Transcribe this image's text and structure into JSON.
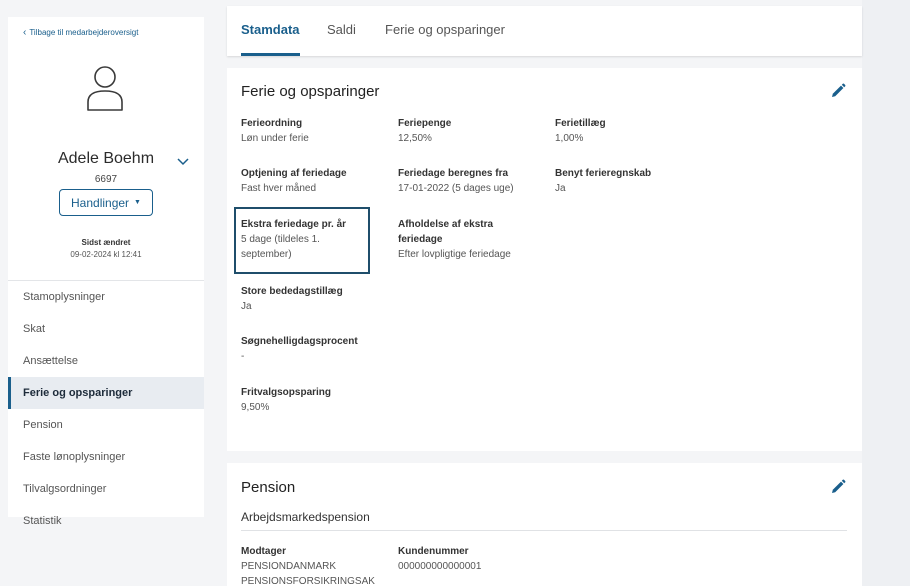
{
  "sidebar": {
    "back_label": "Tilbage til medarbejderoversigt",
    "employee_name": "Adele Boehm",
    "employee_number": "6697",
    "actions_label": "Handlinger",
    "last_changed_label": "Sidst ændret",
    "last_changed_value": "09-02-2024 kl 12:41",
    "nav_items": [
      {
        "label": "Stamoplysninger"
      },
      {
        "label": "Skat"
      },
      {
        "label": "Ansættelse"
      },
      {
        "label": "Ferie og opsparinger"
      },
      {
        "label": "Pension"
      },
      {
        "label": "Faste lønoplysninger"
      },
      {
        "label": "Tilvalgsordninger"
      },
      {
        "label": "Statistik"
      }
    ],
    "active_index": 3
  },
  "tabs": [
    {
      "label": "Stamdata",
      "active": true
    },
    {
      "label": "Saldi",
      "active": false
    },
    {
      "label": "Ferie og opsparinger",
      "active": false
    }
  ],
  "vacation_card": {
    "title": "Ferie og opsparinger",
    "fields": {
      "ferieordning": {
        "label": "Ferieordning",
        "value": "Løn under ferie"
      },
      "feriepenge": {
        "label": "Feriepenge",
        "value": "12,50%"
      },
      "ferietillaeg": {
        "label": "Ferietillæg",
        "value": "1,00%"
      },
      "optjening": {
        "label": "Optjening af feriedage",
        "value": "Fast hver måned"
      },
      "beregnes_fra": {
        "label": "Feriedage beregnes fra",
        "value": "17-01-2022 (5 dages uge)"
      },
      "ferieregnskab": {
        "label": "Benyt ferieregnskab",
        "value": "Ja"
      },
      "ekstra": {
        "label": "Ekstra feriedage pr. år",
        "value_line1": "5 dage (tildeles 1.",
        "value_line2": "september)"
      },
      "afholdelse": {
        "label_line1": "Afholdelse af ekstra",
        "label_line2": "feriedage",
        "value": "Efter lovpligtige feriedage"
      },
      "store_bededag": {
        "label": "Store bededagstillæg",
        "value": "Ja"
      },
      "soegnehelligdag": {
        "label": "Søgnehelligdagsprocent",
        "value": "-"
      },
      "fritvalg": {
        "label": "Fritvalgsopsparing",
        "value": "9,50%"
      }
    }
  },
  "pension_card": {
    "title": "Pension",
    "subtitle": "Arbejdsmarkedspension",
    "fields": {
      "modtager": {
        "label": "Modtager",
        "value_line1": "PENSIONDANMARK",
        "value_line2": "PENSIONSFORSIKRINGSAK"
      },
      "kundenummer": {
        "label": "Kundenummer",
        "value": "000000000000001"
      }
    }
  },
  "icons": {
    "back": "chevron-left-icon",
    "avatar": "user-icon",
    "expand": "chevron-down-icon",
    "dropdown": "caret-down-icon",
    "edit": "pencil-icon"
  },
  "colors": {
    "accent": "#1a5f8c",
    "highlight_border": "#1f4e6b",
    "active_nav_bg": "#e8ecf1",
    "page_bg": "#f4f5f7"
  }
}
